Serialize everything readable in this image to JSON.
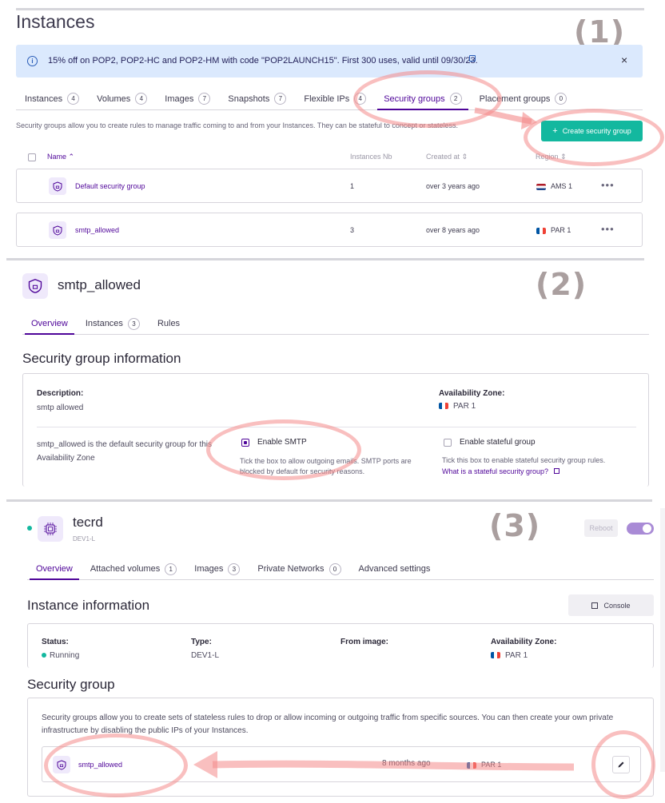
{
  "steps": {
    "one": "(1)",
    "two": "(2)",
    "three": "(3)"
  },
  "panel1": {
    "title": "Instances",
    "banner": {
      "text": "15% off on POP2, POP2-HC and POP2-HM with code \"POP2LAUNCH15\". First 300 uses, valid until 09/30/23.",
      "close": "×"
    },
    "tabs": [
      {
        "label": "Instances",
        "count": "4"
      },
      {
        "label": "Volumes",
        "count": "4"
      },
      {
        "label": "Images",
        "count": "7"
      },
      {
        "label": "Snapshots",
        "count": "7"
      },
      {
        "label": "Flexible IPs",
        "count": "4"
      },
      {
        "label": "Security groups",
        "count": "2"
      },
      {
        "label": "Placement groups",
        "count": "0"
      }
    ],
    "description": "Security groups allow you to create rules to manage traffic coming to and from your Instances. They can be stateful to concept or stateless.",
    "create_button": "Create security group",
    "columns": {
      "name": "Name",
      "instances": "Instances Nb",
      "created": "Created at",
      "region": "Region"
    },
    "rows": [
      {
        "name": "Default security group",
        "instances": "1",
        "created": "over 3 years ago",
        "region": "AMS 1"
      },
      {
        "name": "smtp_allowed",
        "instances": "3",
        "created": "over 8 years ago",
        "region": "PAR 1"
      }
    ]
  },
  "panel2": {
    "title": "smtp_allowed",
    "tabs": [
      {
        "label": "Overview"
      },
      {
        "label": "Instances",
        "count": "3"
      },
      {
        "label": "Rules"
      }
    ],
    "section_title": "Security group information",
    "description_label": "Description:",
    "description_value": "smtp allowed",
    "az_label": "Availability Zone:",
    "az_value": "PAR 1",
    "default_note": "smtp_allowed is the default security group for this Availability Zone",
    "smtp_label": "Enable SMTP",
    "smtp_help": "Tick the box to allow outgoing emails. SMTP ports are blocked by default for security reasons.",
    "stateful_label": "Enable stateful group",
    "stateful_help": "Tick this box to enable stateful security group rules.",
    "stateful_link": "What is a stateful security group?"
  },
  "panel3": {
    "title": "tecrd",
    "subtitle": "DEV1-L",
    "reboot": "Reboot",
    "tabs": [
      {
        "label": "Overview"
      },
      {
        "label": "Attached volumes",
        "count": "1"
      },
      {
        "label": "Images",
        "count": "3"
      },
      {
        "label": "Private Networks",
        "count": "0"
      },
      {
        "label": "Advanced settings"
      }
    ],
    "section_title": "Instance information",
    "console": "Console",
    "status_label": "Status:",
    "status_value": "Running",
    "type_label": "Type:",
    "type_value": "DEV1-L",
    "image_label": "From image:",
    "az_label": "Availability Zone:",
    "az_value": "PAR 1",
    "sg_title": "Security group",
    "sg_description": "Security groups allow you to create sets of stateless rules to drop or allow incoming or outgoing traffic from specific sources. You can then create your own private infrastructure by disabling the public IPs of your Instances.",
    "sg_name": "smtp_allowed",
    "sg_created": "8 months ago",
    "sg_region": "PAR 1"
  },
  "colors": {
    "accent": "#4f0599",
    "primary_button": "#13b89f",
    "highlight": "#f48a8a",
    "running": "#13b89f"
  }
}
